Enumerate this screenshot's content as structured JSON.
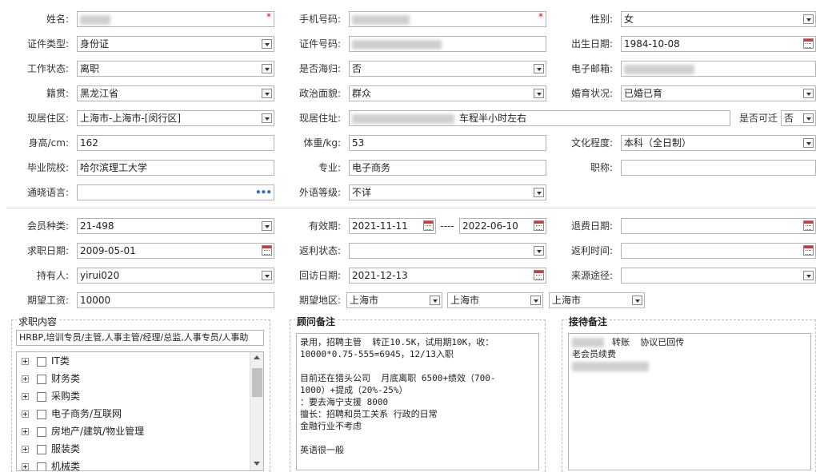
{
  "basic": {
    "name_label": "姓名:",
    "phone_label": "手机号码:",
    "gender_label": "性别:",
    "gender_value": "女",
    "id_type_label": "证件类型:",
    "id_type_value": "身份证",
    "id_no_label": "证件号码:",
    "birth_label": "出生日期:",
    "birth_value": "1984-10-08",
    "work_status_label": "工作状态:",
    "work_status_value": "离职",
    "returnee_label": "是否海归:",
    "returnee_value": "否",
    "email_label": "电子邮箱:",
    "native_label": "籍贯:",
    "native_value": "黑龙江省",
    "political_label": "政治面貌:",
    "political_value": "群众",
    "marital_label": "婚育状况:",
    "marital_value": "已婚已育",
    "residence_label": "现居住区:",
    "residence_value": "上海市-上海市-[闵行区]",
    "address_label": "现居住址:",
    "address_value": "车程半小时左右",
    "relocate_label": "是否可迁",
    "relocate_value": "否",
    "height_label": "身高/cm:",
    "height_value": "162",
    "weight_label": "体重/kg:",
    "weight_value": "53",
    "education_label": "文化程度:",
    "education_value": "本科（全日制）",
    "school_label": "毕业院校:",
    "school_value": "哈尔滨理工大学",
    "major_label": "专业:",
    "major_value": "电子商务",
    "title_label": "职称:",
    "language_label": "通晓语言:",
    "language_dots": "•••",
    "foreign_level_label": "外语等级:",
    "foreign_level_value": "不详"
  },
  "membership": {
    "member_type_label": "会员种类:",
    "member_type_value": "21-498",
    "valid_label": "有效期:",
    "valid_from": "2021-11-11",
    "valid_sep": "----",
    "valid_to": "2022-06-10",
    "refund_date_label": "退费日期:",
    "job_date_label": "求职日期:",
    "job_date_value": "2009-05-01",
    "rebate_status_label": "返利状态:",
    "rebate_time_label": "返利时间:",
    "holder_label": "持有人:",
    "holder_value": "yirui020",
    "visit_date_label": "回访日期:",
    "visit_date_value": "2021-12-13",
    "source_label": "来源途径:",
    "salary_label": "期望工资:",
    "salary_value": "10000",
    "region_label": "期望地区:",
    "region_values": [
      "上海市",
      "上海市",
      "上海市"
    ]
  },
  "job_content": {
    "title": "求职内容",
    "summary": "HRBP,培训专员/主管,人事主管/经理/总监,人事专员/人事助",
    "categories": [
      "IT类",
      "财务类",
      "采购类",
      "电子商务/互联网",
      "房地产/建筑/物业管理",
      "服装类",
      "机械类"
    ]
  },
  "advisor_note": {
    "title": "顾问备注",
    "text": "录用，招聘主管  转正10.5K，试用期10K，收：\n10000*0.75-555=6945，12/13入职\n\n目前还在猎头公司  月底离职 6500+绩效（700-\n1000）+提成（20%-25%）\n：要去海宁支援 8000\n擅长：招聘和员工关系 行政的日常\n金融行业不考虑\n\n英语很一般"
  },
  "reception_note": {
    "title": "接待备注",
    "line1": "转账  协议已回传",
    "line2": "老会员续费"
  },
  "colors": {
    "required": "#e00000",
    "border": "#b4b4b4",
    "accent": "#3a6fc8"
  }
}
